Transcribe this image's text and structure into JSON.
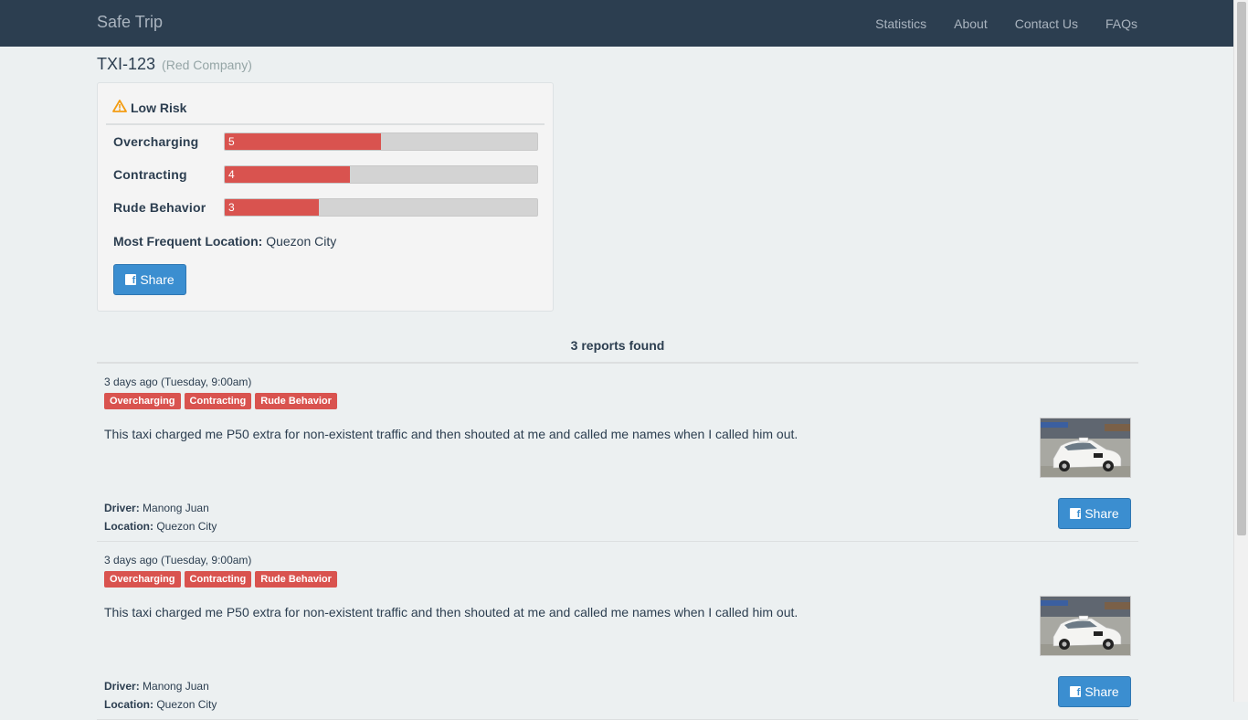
{
  "navbar": {
    "brand": "Safe Trip",
    "links": [
      "Statistics",
      "About",
      "Contact Us",
      "FAQs"
    ]
  },
  "taxi": {
    "plate": "TXI-123",
    "company": "(Red Company)"
  },
  "summary": {
    "risk_label": "Low Risk",
    "stats": [
      {
        "label": "Overcharging",
        "value": "5",
        "fraction": 0.5
      },
      {
        "label": "Contracting",
        "value": "4",
        "fraction": 0.4
      },
      {
        "label": "Rude Behavior",
        "value": "3",
        "fraction": 0.3
      }
    ],
    "location_label": "Most Frequent Location:",
    "location_value": "Quezon City",
    "share_label": "Share"
  },
  "reports": {
    "count_text": "3 reports found",
    "items": [
      {
        "time": "3 days ago (Tuesday, 9:00am)",
        "tags": [
          "Overcharging",
          "Contracting",
          "Rude Behavior"
        ],
        "text": "This taxi charged me P50 extra for non-existent traffic and then shouted at me and called me names when I called him out.",
        "driver_label": "Driver:",
        "driver": "Manong Juan",
        "location_label": "Location:",
        "location": "Quezon City",
        "share_label": "Share"
      },
      {
        "time": "3 days ago (Tuesday, 9:00am)",
        "tags": [
          "Overcharging",
          "Contracting",
          "Rude Behavior"
        ],
        "text": "This taxi charged me P50 extra for non-existent traffic and then shouted at me and called me names when I called him out.",
        "driver_label": "Driver:",
        "driver": "Manong Juan",
        "location_label": "Location:",
        "location": "Quezon City",
        "share_label": "Share"
      }
    ]
  },
  "colors": {
    "navbar": "#2c3e50",
    "danger": "#d9534f",
    "primary": "#3b8ed0",
    "warning": "#f39c12"
  }
}
